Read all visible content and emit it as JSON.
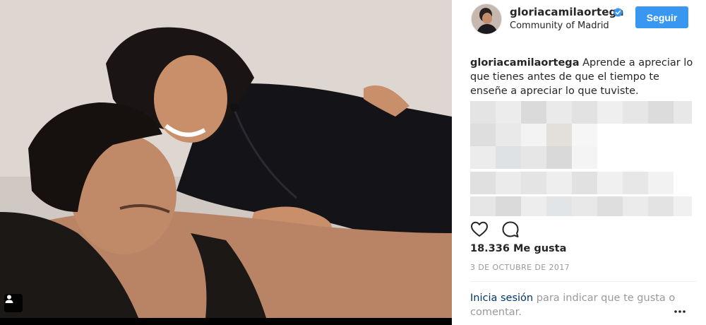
{
  "post": {
    "photo_label": "photo",
    "user_tag_icon": "user-tag-icon"
  },
  "header": {
    "username": "gloriacamilaortega",
    "verified_icon": "verified-badge-icon",
    "location": "Community of Madrid",
    "follow_label": "Seguir"
  },
  "caption": {
    "username": "gloriacamilaortega",
    "text": " Aprende a apreciar lo que tienes antes de que el tiempo te enseñe a apreciar lo que tuviste."
  },
  "actions": {
    "like_icon": "heart-icon",
    "comment_icon": "comment-icon",
    "more_icon": "more-options-icon"
  },
  "likes": {
    "text": "18.336 Me gusta"
  },
  "date": {
    "text": "3 DE OCTUBRE DE 2017"
  },
  "login": {
    "link_text": "Inicia sesión",
    "rest_text": " para indicar que te gusta o comentar."
  },
  "colors": {
    "accent": "#3897f0",
    "link": "#003569",
    "muted": "#999999"
  }
}
